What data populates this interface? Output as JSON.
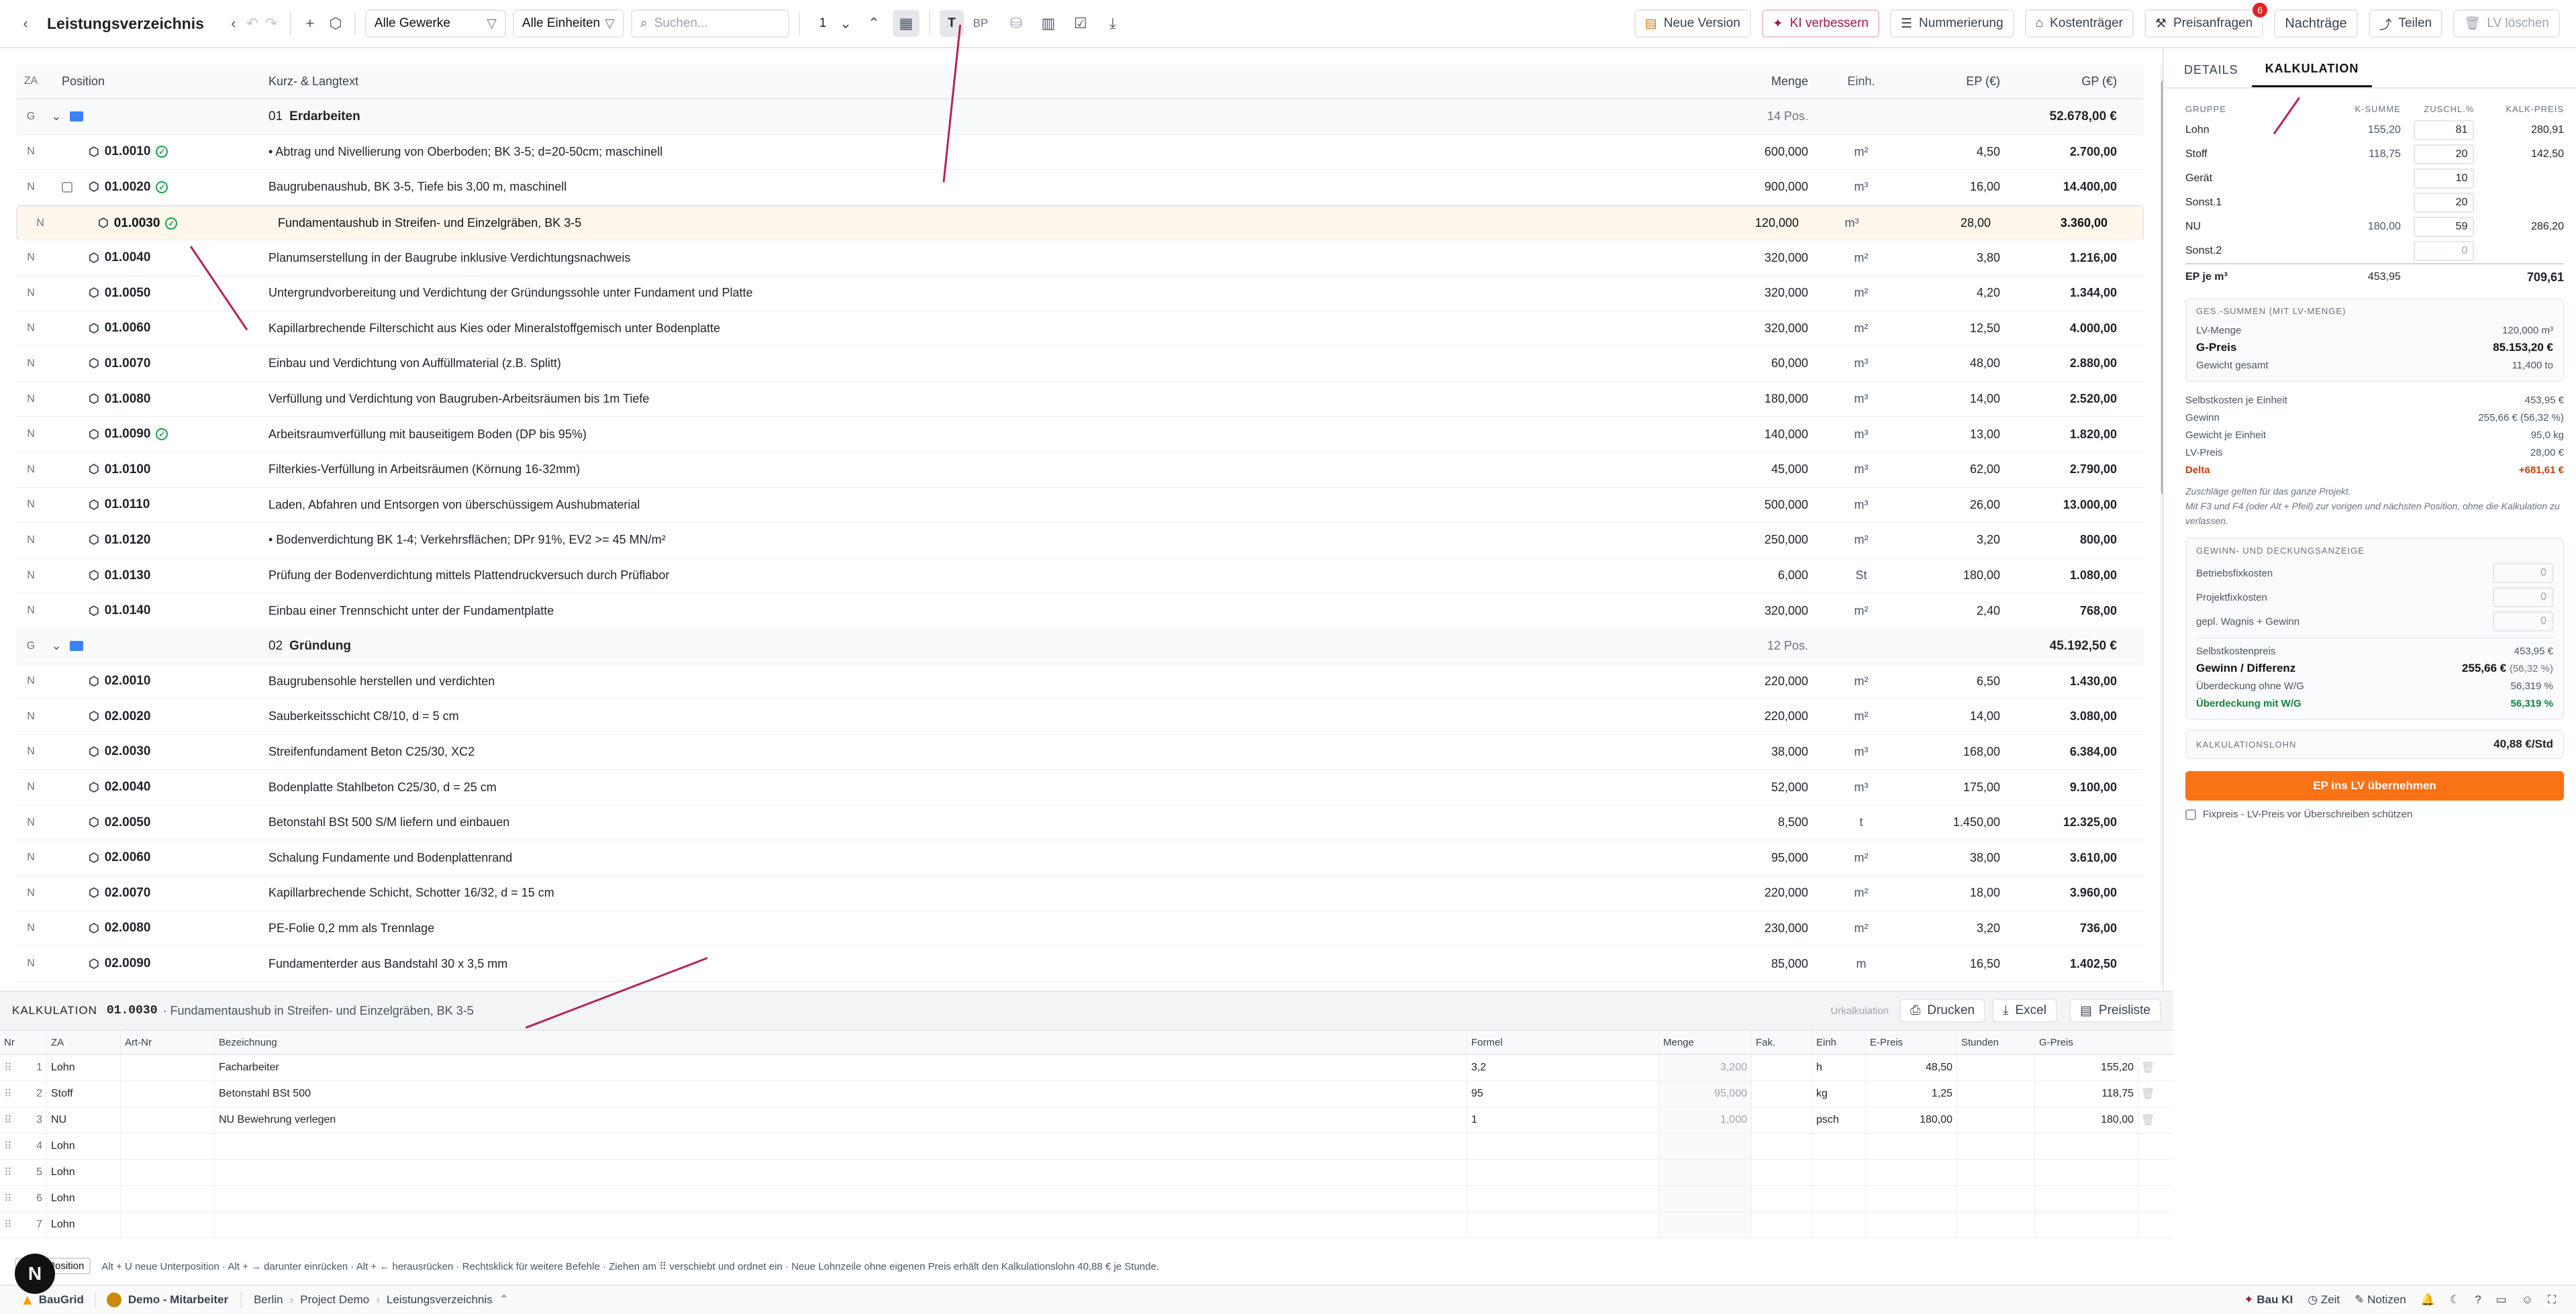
{
  "toolbar": {
    "title": "Leistungsverzeichnis",
    "filter_gewerke": "Alle Gewerke",
    "filter_einheiten": "Alle Einheiten",
    "search_placeholder": "Suchen...",
    "level": "1",
    "t_label": "T",
    "bp_label": "BP",
    "neue_version": "Neue Version",
    "ki_verbessern": "KI verbessern",
    "nummerierung": "Nummerierung",
    "kostentraeger": "Kostenträger",
    "preisanfragen": "Preisanfragen",
    "preisanfragen_badge": "6",
    "nachtraege": "Nachträge",
    "teilen": "Teilen",
    "lv_loeschen": "LV löschen"
  },
  "grid": {
    "headers": {
      "za": "ZA",
      "position": "Position",
      "text": "Kurz- & Langtext",
      "menge": "Menge",
      "einh": "Einh.",
      "ep": "EP (€)",
      "gp": "GP (€)"
    },
    "rows": [
      {
        "type": "group",
        "za": "G",
        "nr": "01",
        "name": "Erdarbeiten",
        "count": "14 Pos.",
        "gp": "52.678,00 €"
      },
      {
        "za": "N",
        "pos": "01.0010",
        "ok": true,
        "text": "• Abtrag und Nivellierung von Oberboden; BK 3-5; d=20-50cm; maschinell",
        "menge": "600,000",
        "einh": "m²",
        "ep": "4,50",
        "gp": "2.700,00"
      },
      {
        "za": "N",
        "pos": "01.0020",
        "ok": true,
        "chk": true,
        "text": "Baugrubenaushub, BK 3-5, Tiefe bis 3,00 m, maschinell",
        "menge": "900,000",
        "einh": "m³",
        "ep": "16,00",
        "gp": "14.400,00"
      },
      {
        "za": "N",
        "pos": "01.0030",
        "ok": true,
        "sel": true,
        "text": "Fundamentaushub in Streifen- und Einzelgräben, BK 3-5",
        "menge": "120,000",
        "einh": "m³",
        "ep": "28,00",
        "gp": "3.360,00"
      },
      {
        "za": "N",
        "pos": "01.0040",
        "text": "Planumserstellung in der Baugrube inklusive Verdichtungsnachweis",
        "menge": "320,000",
        "einh": "m²",
        "ep": "3,80",
        "gp": "1.216,00"
      },
      {
        "za": "N",
        "pos": "01.0050",
        "text": "Untergrundvorbereitung und Verdichtung der Gründungssohle unter Fundament und Platte",
        "menge": "320,000",
        "einh": "m²",
        "ep": "4,20",
        "gp": "1.344,00"
      },
      {
        "za": "N",
        "pos": "01.0060",
        "text": "Kapillarbrechende Filterschicht aus Kies oder Mineralstoffgemisch unter Bodenplatte",
        "menge": "320,000",
        "einh": "m²",
        "ep": "12,50",
        "gp": "4.000,00"
      },
      {
        "za": "N",
        "pos": "01.0070",
        "text": "Einbau und Verdichtung von Auffüllmaterial (z.B. Splitt)",
        "menge": "60,000",
        "einh": "m³",
        "ep": "48,00",
        "gp": "2.880,00"
      },
      {
        "za": "N",
        "pos": "01.0080",
        "text": "Verfüllung und Verdichtung von Baugruben-Arbeitsräumen bis 1m Tiefe",
        "menge": "180,000",
        "einh": "m³",
        "ep": "14,00",
        "gp": "2.520,00"
      },
      {
        "za": "N",
        "pos": "01.0090",
        "ok": true,
        "text": "Arbeitsraumverfüllung mit bauseitigem Boden (DP bis 95%)",
        "menge": "140,000",
        "einh": "m³",
        "ep": "13,00",
        "gp": "1.820,00"
      },
      {
        "za": "N",
        "pos": "01.0100",
        "text": "Filterkies-Verfüllung in Arbeitsräumen (Körnung 16-32mm)",
        "menge": "45,000",
        "einh": "m³",
        "ep": "62,00",
        "gp": "2.790,00"
      },
      {
        "za": "N",
        "pos": "01.0110",
        "text": "Laden, Abfahren und Entsorgen von überschüssigem Aushubmaterial",
        "menge": "500,000",
        "einh": "m³",
        "ep": "26,00",
        "gp": "13.000,00"
      },
      {
        "za": "N",
        "pos": "01.0120",
        "text": "• Bodenverdichtung BK 1-4; Verkehrsflächen; DPr 91%, EV2 >= 45 MN/m²",
        "menge": "250,000",
        "einh": "m²",
        "ep": "3,20",
        "gp": "800,00"
      },
      {
        "za": "N",
        "pos": "01.0130",
        "text": "Prüfung der Bodenverdichtung mittels Plattendruckversuch durch Prüflabor",
        "menge": "6,000",
        "einh": "St",
        "ep": "180,00",
        "gp": "1.080,00"
      },
      {
        "za": "N",
        "pos": "01.0140",
        "text": "Einbau einer Trennschicht unter der Fundamentplatte",
        "menge": "320,000",
        "einh": "m²",
        "ep": "2,40",
        "gp": "768,00"
      },
      {
        "type": "group",
        "za": "G",
        "nr": "02",
        "name": "Gründung",
        "count": "12 Pos.",
        "gp": "45.192,50 €"
      },
      {
        "za": "N",
        "pos": "02.0010",
        "text": "Baugrubensohle herstellen und verdichten",
        "menge": "220,000",
        "einh": "m²",
        "ep": "6,50",
        "gp": "1.430,00"
      },
      {
        "za": "N",
        "pos": "02.0020",
        "text": "Sauberkeitsschicht C8/10, d = 5 cm",
        "menge": "220,000",
        "einh": "m²",
        "ep": "14,00",
        "gp": "3.080,00"
      },
      {
        "za": "N",
        "pos": "02.0030",
        "text": "Streifenfundament Beton C25/30, XC2",
        "menge": "38,000",
        "einh": "m³",
        "ep": "168,00",
        "gp": "6.384,00"
      },
      {
        "za": "N",
        "pos": "02.0040",
        "text": "Bodenplatte Stahlbeton C25/30, d = 25 cm",
        "menge": "52,000",
        "einh": "m³",
        "ep": "175,00",
        "gp": "9.100,00"
      },
      {
        "za": "N",
        "pos": "02.0050",
        "text": "Betonstahl BSt 500 S/M liefern und einbauen",
        "menge": "8,500",
        "einh": "t",
        "ep": "1.450,00",
        "gp": "12.325,00"
      },
      {
        "za": "N",
        "pos": "02.0060",
        "text": "Schalung Fundamente und Bodenplattenrand",
        "menge": "95,000",
        "einh": "m²",
        "ep": "38,00",
        "gp": "3.610,00"
      },
      {
        "za": "N",
        "pos": "02.0070",
        "text": "Kapillarbrechende Schicht, Schotter 16/32, d = 15 cm",
        "menge": "220,000",
        "einh": "m²",
        "ep": "18,00",
        "gp": "3.960,00"
      },
      {
        "za": "N",
        "pos": "02.0080",
        "text": "PE-Folie 0,2 mm als Trennlage",
        "menge": "230,000",
        "einh": "m²",
        "ep": "3,20",
        "gp": "736,00"
      },
      {
        "za": "N",
        "pos": "02.0090",
        "text": "Fundamenterder aus Bandstahl 30 x 3,5 mm",
        "menge": "85,000",
        "einh": "m",
        "ep": "16,50",
        "gp": "1.402,50"
      }
    ]
  },
  "panel": {
    "tab_details": "DETAILS",
    "tab_kalkulation": "KALKULATION",
    "headers": {
      "gruppe": "GRUPPE",
      "ksumme": "K-SUMME",
      "zuschl": "ZUSCHL.%",
      "kalk": "KALK-PREIS"
    },
    "rows": [
      {
        "name": "Lohn",
        "ksumme": "155,20",
        "zuschl": "81",
        "kalk": "280,91"
      },
      {
        "name": "Stoff",
        "ksumme": "118,75",
        "zuschl": "20",
        "kalk": "142,50"
      },
      {
        "name": "Gerät",
        "ksumme": "",
        "zuschl": "10",
        "kalk": ""
      },
      {
        "name": "Sonst.1",
        "ksumme": "",
        "zuschl": "20",
        "kalk": ""
      },
      {
        "name": "NU",
        "ksumme": "180,00",
        "zuschl": "59",
        "kalk": "286,20"
      },
      {
        "name": "Sonst.2",
        "ksumme": "",
        "zuschl": "0",
        "kalk": ""
      }
    ],
    "ep_label": "EP je m³",
    "ep_ksumme": "453,95",
    "ep_kalk": "709,61",
    "ges": {
      "title": "GES.-SUMMEN (MIT LV-MENGE)",
      "lv_menge_label": "LV-Menge",
      "lv_menge": "120,000 m³",
      "gpreis_label": "G-Preis",
      "gpreis": "85.153,20 €",
      "gewicht_label": "Gewicht gesamt",
      "gewicht": "11,400 to"
    },
    "stats": [
      {
        "label": "Selbstkosten je Einheit",
        "value": "453,95 €"
      },
      {
        "label": "Gewinn",
        "value": "255,66 € (56,32 %)"
      },
      {
        "label": "Gewicht je Einheit",
        "value": "95,0 kg"
      },
      {
        "label": "LV-Preis",
        "value": "28,00 €"
      }
    ],
    "delta_label": "Delta",
    "delta_value": "+681,61 €",
    "note1": "Zuschläge gelten für das ganze Projekt.",
    "note2": "Mit F3 und F4 (oder Alt + Pfeil) zur vorigen und nächsten Position, ohne die Kalkulation zu verlassen.",
    "gd": {
      "title": "GEWINN- UND DECKUNGSANZEIGE",
      "betrieb_label": "Betriebsfixkosten",
      "betrieb": "0",
      "projekt_label": "Projektfixkosten",
      "projekt": "0",
      "wagnis_label": "gepl. Wagnis + Gewinn",
      "wagnis": "0",
      "selbst_label": "Selbstkostenpreis",
      "selbst": "453,95 €",
      "gewinn_label": "Gewinn / Differenz",
      "gewinn": "255,66 €",
      "gewinn_pct": "(56,32 %)",
      "ohne_label": "Überdeckung ohne W/G",
      "ohne": "56,319 %",
      "mit_label": "Überdeckung mit W/G",
      "mit": "56,319 %"
    },
    "lohn_label": "KALKULATIONSLOHN",
    "lohn_value": "40,88 €/Std",
    "apply_button": "EP ins LV übernehmen",
    "fixpreis_label": "Fixpreis - LV-Preis vor Überschreiben schützen",
    "colors": {
      "accent": "#f97316",
      "delta": "#c2410c",
      "positive": "#15803d",
      "arrow": "#b3245e"
    }
  },
  "bottom": {
    "title": "KALKULATION",
    "pos": "01.0030",
    "subtitle": "· Fundamentaushub in Streifen- und Einzelgräben, BK 3-5",
    "urkalk": "Urkalkulation",
    "drucken": "Drucken",
    "excel": "Excel",
    "preisliste": "Preisliste",
    "headers": {
      "nr": "Nr",
      "za": "ZA",
      "artnr": "Art-Nr",
      "bez": "Bezeichnung",
      "formel": "Formel",
      "menge": "Menge",
      "fak": "Fak.",
      "einh": "Einh",
      "epreis": "E-Preis",
      "stunden": "Stunden",
      "gpreis": "G-Preis"
    },
    "rows": [
      {
        "nr": "1",
        "za": "Lohn",
        "bez": "Facharbeiter",
        "formel": "3,2",
        "menge": "3,200",
        "einh": "h",
        "epreis": "48,50",
        "gpreis": "155,20"
      },
      {
        "nr": "2",
        "za": "Stoff",
        "bez": "Betonstahl BSt 500",
        "formel": "95",
        "menge": "95,000",
        "einh": "kg",
        "epreis": "1,25",
        "gpreis": "118,75"
      },
      {
        "nr": "3",
        "za": "NU",
        "bez": "NU Bewehrung verlegen",
        "formel": "1",
        "menge": "1,000",
        "einh": "psch",
        "epreis": "180,00",
        "gpreis": "180,00"
      },
      {
        "nr": "4",
        "za": "Lohn",
        "bez": "",
        "formel": "",
        "menge": "",
        "einh": "",
        "epreis": "",
        "gpreis": ""
      },
      {
        "nr": "5",
        "za": "Lohn",
        "bez": "",
        "formel": "",
        "menge": "",
        "einh": "",
        "epreis": "",
        "gpreis": ""
      },
      {
        "nr": "6",
        "za": "Lohn",
        "bez": "",
        "formel": "",
        "menge": "",
        "einh": "",
        "epreis": "",
        "gpreis": ""
      },
      {
        "nr": "7",
        "za": "Lohn",
        "bez": "",
        "formel": "",
        "menge": "",
        "einh": "",
        "epreis": "",
        "gpreis": ""
      }
    ],
    "hint_chip": "Position",
    "hint": "Alt + U neue Unterposition · Alt + → darunter einrücken · Alt + ← herausrücken · Rechtsklick für weitere Befehle · Ziehen am ⠿ verschiebt und ordnet ein · Neue Lohnzeile ohne eigenen Preis erhält den Kalkulationslohn 40,88 € je Stunde."
  },
  "status": {
    "avatar": "N",
    "app": "BauGrid",
    "user": "Demo - Mitarbeiter",
    "crumbs": [
      "Berlin",
      "Project Demo",
      "Leistungsverzeichnis"
    ],
    "bau_ki": "Bau KI",
    "zeit": "Zeit",
    "notizen": "Notizen"
  }
}
